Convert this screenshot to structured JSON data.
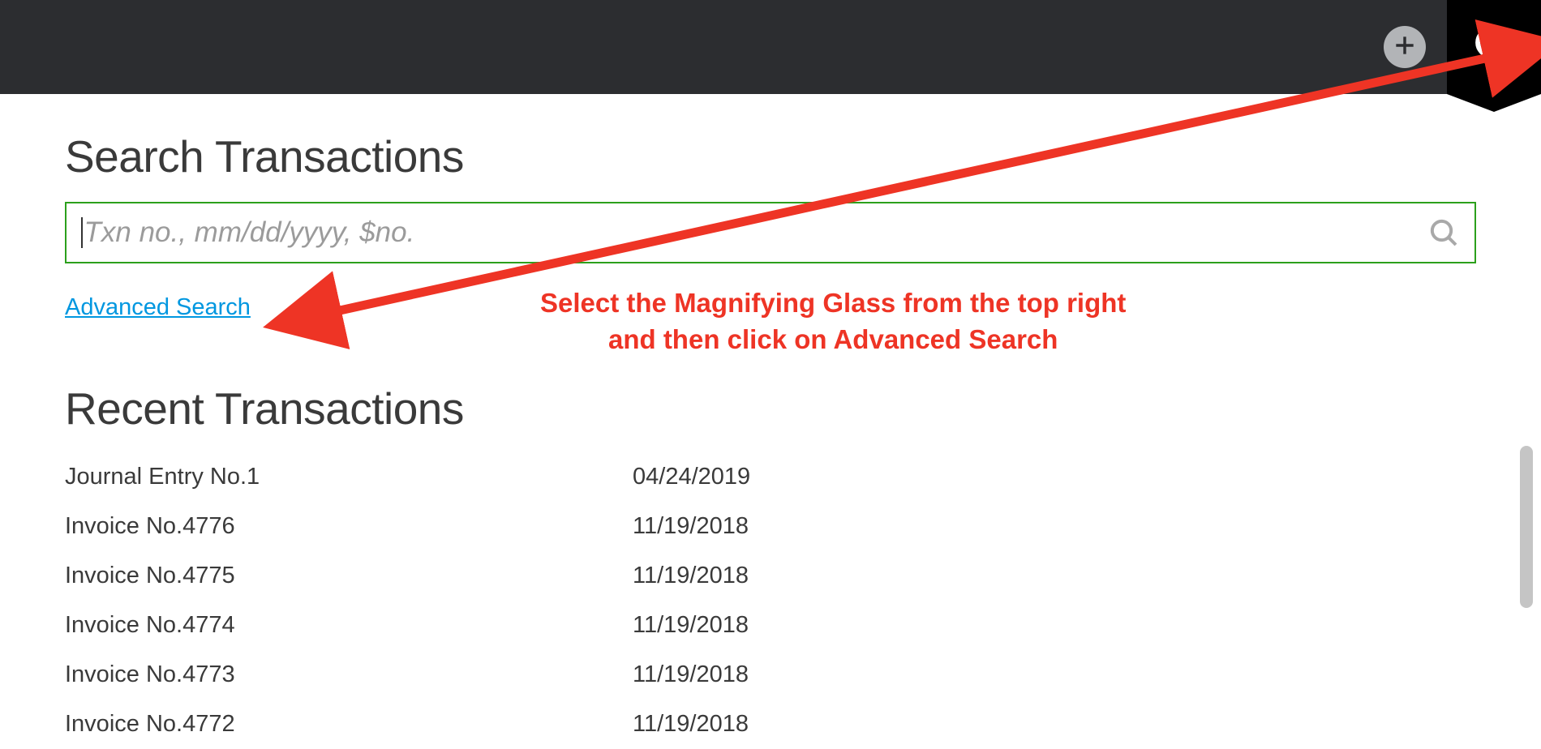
{
  "topbar": {
    "plus_icon": "plus",
    "search_icon": "search"
  },
  "search": {
    "title": "Search Transactions",
    "placeholder": "Txn no., mm/dd/yyyy, $no.",
    "advanced_link": "Advanced Search"
  },
  "recent": {
    "title": "Recent Transactions",
    "items": [
      {
        "name": "Journal Entry No.1",
        "date": "04/24/2019"
      },
      {
        "name": "Invoice No.4776",
        "date": "11/19/2018"
      },
      {
        "name": "Invoice No.4775",
        "date": "11/19/2018"
      },
      {
        "name": "Invoice No.4774",
        "date": "11/19/2018"
      },
      {
        "name": "Invoice No.4773",
        "date": "11/19/2018"
      },
      {
        "name": "Invoice No.4772",
        "date": "11/19/2018"
      }
    ]
  },
  "annotation": {
    "line1": "Select the Magnifying Glass from the top right",
    "line2": "and then click on Advanced Search"
  }
}
